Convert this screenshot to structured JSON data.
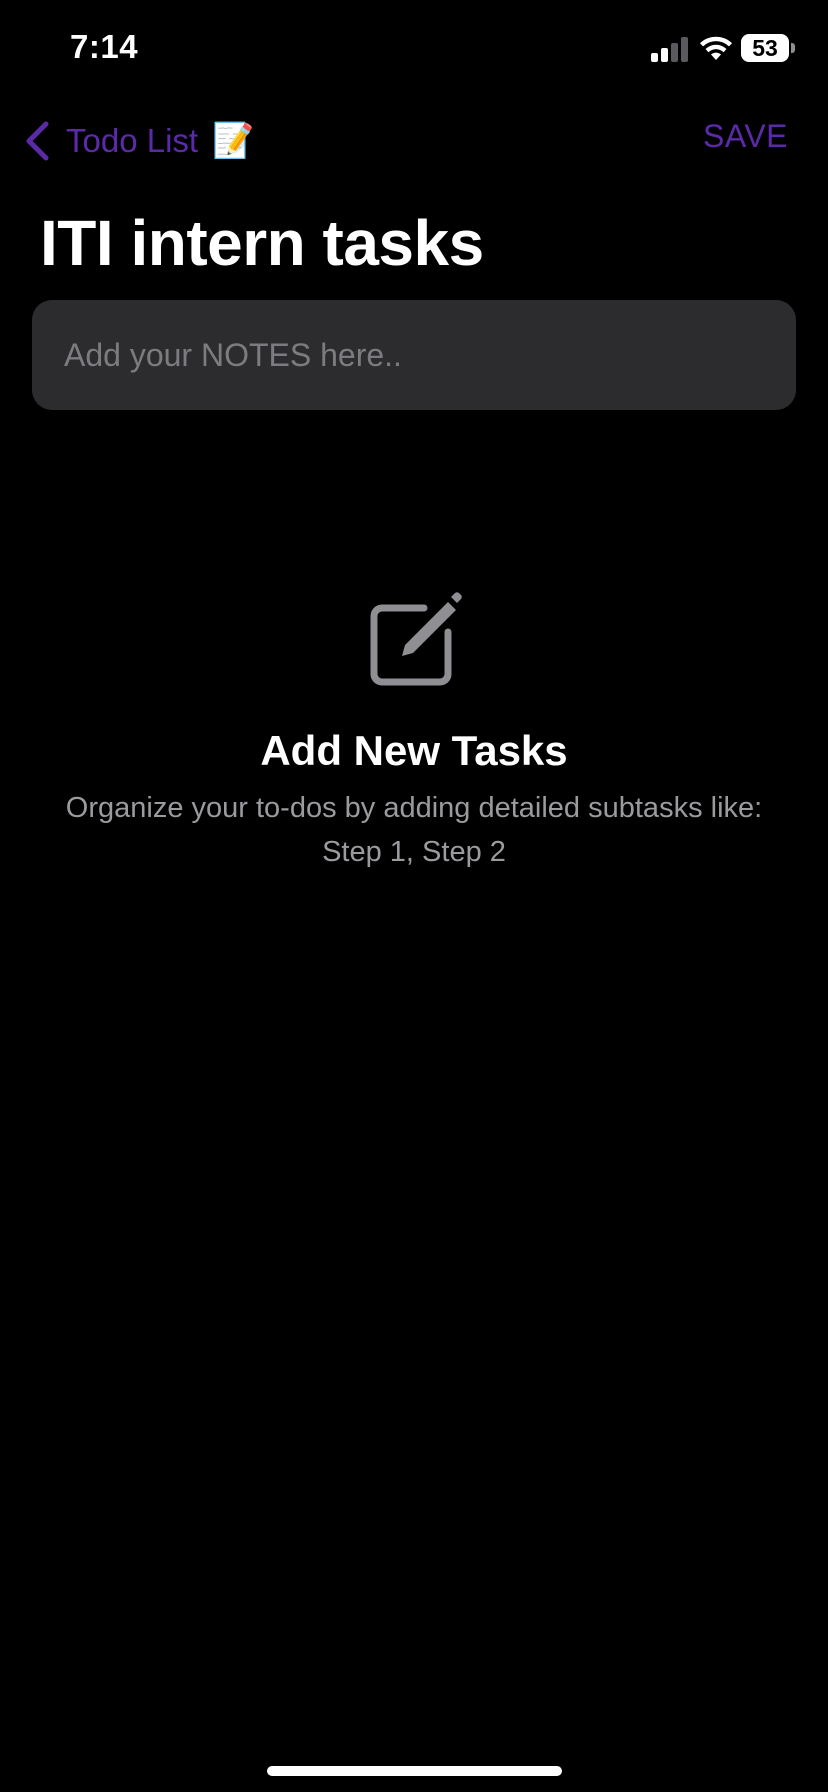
{
  "status_bar": {
    "time": "7:14",
    "battery_level": "53",
    "signal_bars_active": 2,
    "signal_bars_total": 4
  },
  "nav": {
    "back_label": "Todo List",
    "back_emoji": "📝",
    "save_label": "SAVE",
    "accent_color": "#5b2aa8"
  },
  "title": "ITI intern tasks",
  "notes": {
    "value": "",
    "placeholder": "Add your NOTES here.."
  },
  "empty_state": {
    "icon": "compose-icon",
    "title": "Add New Tasks",
    "description": "Organize your to-dos by adding detailed subtasks like: Step 1, Step 2"
  }
}
